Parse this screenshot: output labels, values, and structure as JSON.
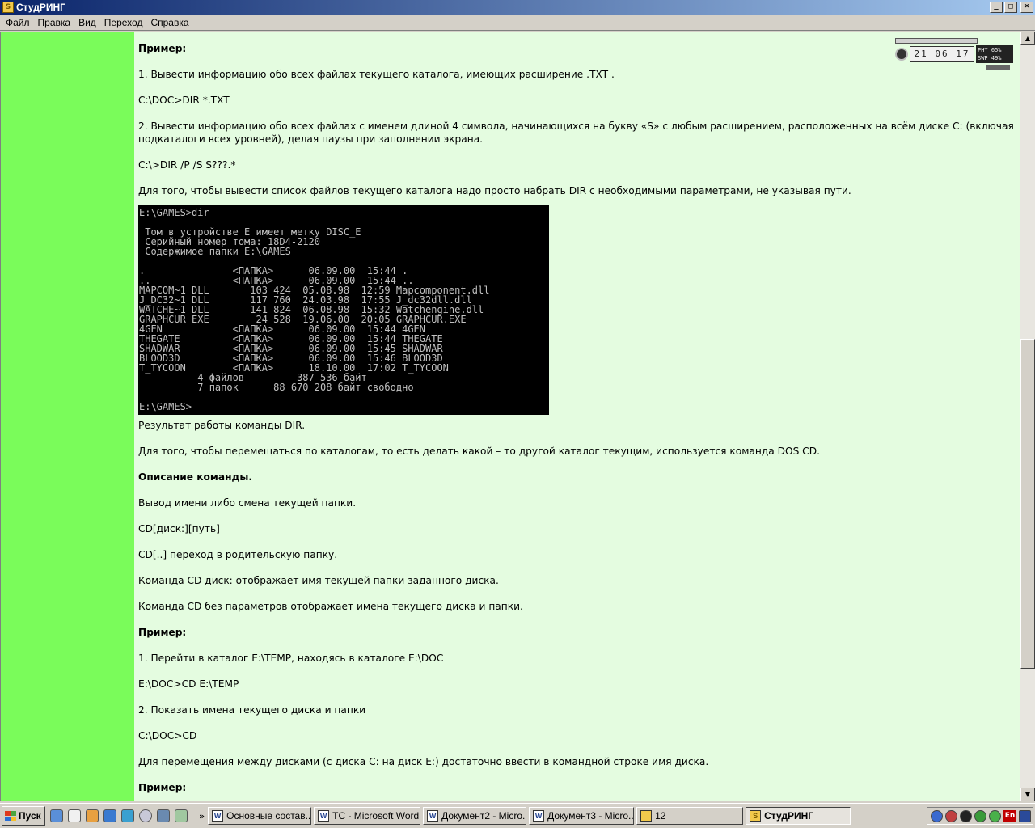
{
  "window": {
    "title": "СтудРИНГ",
    "buttons": [
      "_",
      "□",
      "×"
    ]
  },
  "menu": [
    "Файл",
    "Правка",
    "Вид",
    "Переход",
    "Справка"
  ],
  "gadget": {
    "clock": "21 06 17",
    "phy_label": "PHY",
    "phy_value": "65%",
    "swp_label": "SWP",
    "swp_value": "49%"
  },
  "article": {
    "p1": "Пример:",
    "p2": "1. Вывести информацию обо всех файлах текущего каталога, имеющих расширение .TXT .",
    "p3": "C:\\DOC>DIR *.TXT",
    "p4": "2. Вывести информацию обо всех файлах с именем длиной 4 символа, начинающихся на букву «S» с любым расширением, расположенных на всём диске C: (включая подкаталоги всех уровней), делая паузы при заполнении экрана.",
    "p5": "C:\\>DIR /P /S S???.*",
    "p6": "Для того, чтобы вывести список файлов текущего каталога надо просто набрать DIR с необходимыми параметрами, не указывая пути.",
    "console": "E:\\GAMES>dir\n\n Том в устройстве E имеет метку DISC_E\n Серийный номер тома: 18D4-2120\n Содержимое папки E:\\GAMES\n\n.               <ПАПКА>      06.09.00  15:44 .\n..              <ПАПКА>      06.09.00  15:44 ..\nMAPCOM~1 DLL       103 424  05.08.98  12:59 Mapcomponent.dll\nJ_DC32~1 DLL       117 760  24.03.98  17:55 J_dc32dll.dll\nWATCHE~1 DLL       141 824  06.08.98  15:32 Watchengine.dll\nGRAPHCUR EXE        24 528  19.06.00  20:05 GRAPHCUR.EXE\n4GEN            <ПАПКА>      06.09.00  15:44 4GEN\nTHEGATE         <ПАПКА>      06.09.00  15:44 THEGATE\nSHADWAR         <ПАПКА>      06.09.00  15:45 SHADWAR\nBLOOD3D         <ПАПКА>      06.09.00  15:46 BLOOD3D\nT_TYCOON        <ПАПКА>      18.10.00  17:02 T_TYCOON\n          4 файлов         387 536 байт\n          7 папок      88 670 208 байт свободно\n\nE:\\GAMES>_",
    "caption": "Результат работы команды DIR.",
    "p7": "Для того, чтобы перемещаться по каталогам, то есть делать какой – то другой каталог текущим, используется команда DOS CD.",
    "p8": "Описание команды.",
    "p9": "Вывод имени либо смена текущей папки.",
    "p10": "CD[диск:][путь]",
    "p11": "CD[..] переход в родительскую папку.",
    "p12": "Команда CD диск: отображает имя текущей папки заданного диска.",
    "p13": "Команда CD без параметров отображает имена текущего диска и папки.",
    "p14": "Пример:",
    "p15": "1. Перейти в каталог E:\\TEMP, находясь в каталоге E:\\DOC",
    "p16": "E:\\DOC>CD E:\\TEMP",
    "p17": "2. Показать имена текущего диска и папки",
    "p18": "C:\\DOC>CD",
    "p19": "Для перемещения между дисками (с диска C: на диск E:) достаточно ввести в командной строке имя диска.",
    "p20": "Пример:"
  },
  "taskbar": {
    "start": "Пуск",
    "chevron": "»",
    "tasks": [
      "Основные состав...",
      "TC - Microsoft Word",
      "Документ2 - Micro...",
      "Документ3 - Micro...",
      "12",
      "СтудРИНГ"
    ],
    "lang": "En"
  },
  "colors": {
    "side": "#7afc5a",
    "content_bg": "#e4fce0",
    "titlebar": "#0a246a"
  }
}
